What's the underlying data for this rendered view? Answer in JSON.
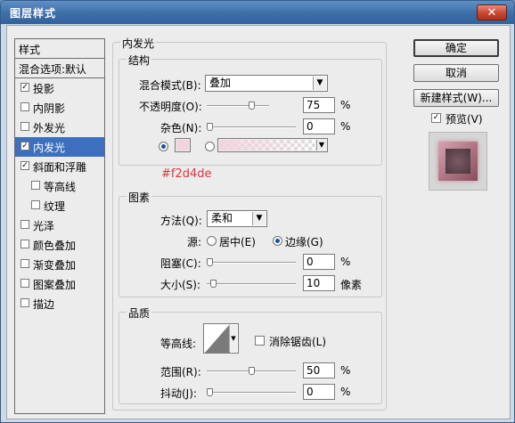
{
  "window": {
    "title": "图层样式",
    "close_glyph": "✕"
  },
  "style_list": {
    "header": "样式",
    "blend_options": "混合选项:默认",
    "items": [
      {
        "label": "投影",
        "checked": true
      },
      {
        "label": "内阴影",
        "checked": false
      },
      {
        "label": "外发光",
        "checked": false
      },
      {
        "label": "内发光",
        "checked": true,
        "selected": true
      },
      {
        "label": "斜面和浮雕",
        "checked": true
      },
      {
        "label": "等高线",
        "checked": false,
        "indent": true
      },
      {
        "label": "纹理",
        "checked": false,
        "indent": true
      },
      {
        "label": "光泽",
        "checked": false
      },
      {
        "label": "颜色叠加",
        "checked": false
      },
      {
        "label": "渐变叠加",
        "checked": false
      },
      {
        "label": "图案叠加",
        "checked": false
      },
      {
        "label": "描边",
        "checked": false
      }
    ]
  },
  "panel": {
    "title": "内发光",
    "structure": {
      "title": "结构",
      "blend_mode_label": "混合模式(B):",
      "blend_mode_value": "叠加",
      "opacity_label": "不透明度(O):",
      "opacity_value": "75",
      "noise_label": "杂色(N):",
      "noise_value": "0",
      "percent": "%"
    },
    "color_annotation": "#f2d4de",
    "color_swatch": "#f2d4de",
    "elements": {
      "title": "图素",
      "technique_label": "方法(Q):",
      "technique_value": "柔和",
      "source_label": "源:",
      "source_center": "居中(E)",
      "source_edge": "边缘(G)",
      "choke_label": "阻塞(C):",
      "choke_value": "0",
      "size_label": "大小(S):",
      "size_value": "10",
      "size_unit": "像素",
      "percent": "%"
    },
    "quality": {
      "title": "品质",
      "contour_label": "等高线:",
      "antialias_label": "消除锯齿(L)",
      "range_label": "范围(R):",
      "range_value": "50",
      "jitter_label": "抖动(J):",
      "jitter_value": "0",
      "percent": "%"
    }
  },
  "buttons": {
    "ok": "确定",
    "cancel": "取消",
    "new_style": "新建样式(W)...",
    "preview": "预览(V)"
  },
  "colors": {
    "selection": "#3c6fbd",
    "annotation": "#e0333f",
    "glow": "#f2d4de"
  }
}
